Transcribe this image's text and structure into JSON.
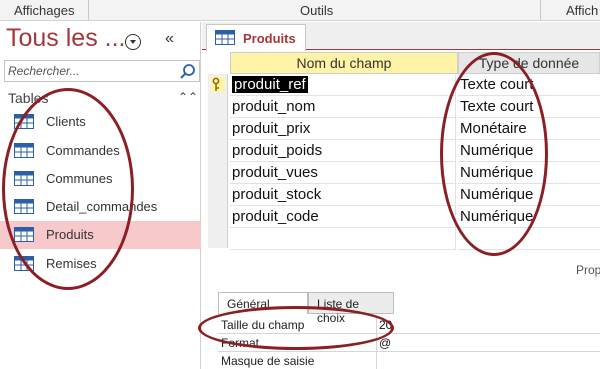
{
  "ribbon": {
    "groups": [
      "Affichages",
      "Outils",
      "Affich"
    ]
  },
  "nav": {
    "title": "Tous les ...",
    "search_placeholder": "Rechercher...",
    "section": "Tables",
    "items": [
      {
        "label": "Clients",
        "selected": false
      },
      {
        "label": "Commandes",
        "selected": false
      },
      {
        "label": "Communes",
        "selected": false
      },
      {
        "label": "Detail_commandes",
        "selected": false
      },
      {
        "label": "Produits",
        "selected": true
      },
      {
        "label": "Remises",
        "selected": false
      }
    ]
  },
  "document": {
    "tab_label": "Produits",
    "columns": [
      "Nom du champ",
      "Type de donnée"
    ],
    "rows": [
      {
        "name": "produit_ref",
        "type": "Texte court",
        "key": true,
        "active": true
      },
      {
        "name": "produit_nom",
        "type": "Texte court"
      },
      {
        "name": "produit_prix",
        "type": "Monétaire"
      },
      {
        "name": "produit_poids",
        "type": "Numérique"
      },
      {
        "name": "produit_vues",
        "type": "Numérique"
      },
      {
        "name": "produit_stock",
        "type": "Numérique"
      },
      {
        "name": "produit_code",
        "type": "Numérique"
      }
    ]
  },
  "properties": {
    "label": "Prop",
    "tabs": [
      "Général",
      "Liste de choix"
    ],
    "rows": [
      {
        "key": "Taille du champ",
        "value": "20"
      },
      {
        "key": "Format",
        "value": "@"
      },
      {
        "key": "Masque de saisie",
        "value": ""
      }
    ]
  },
  "colors": {
    "accent": "#a4373a",
    "selection": "#f8c9cb",
    "header_name": "#fff3a8",
    "annotation": "#8c1f24"
  }
}
